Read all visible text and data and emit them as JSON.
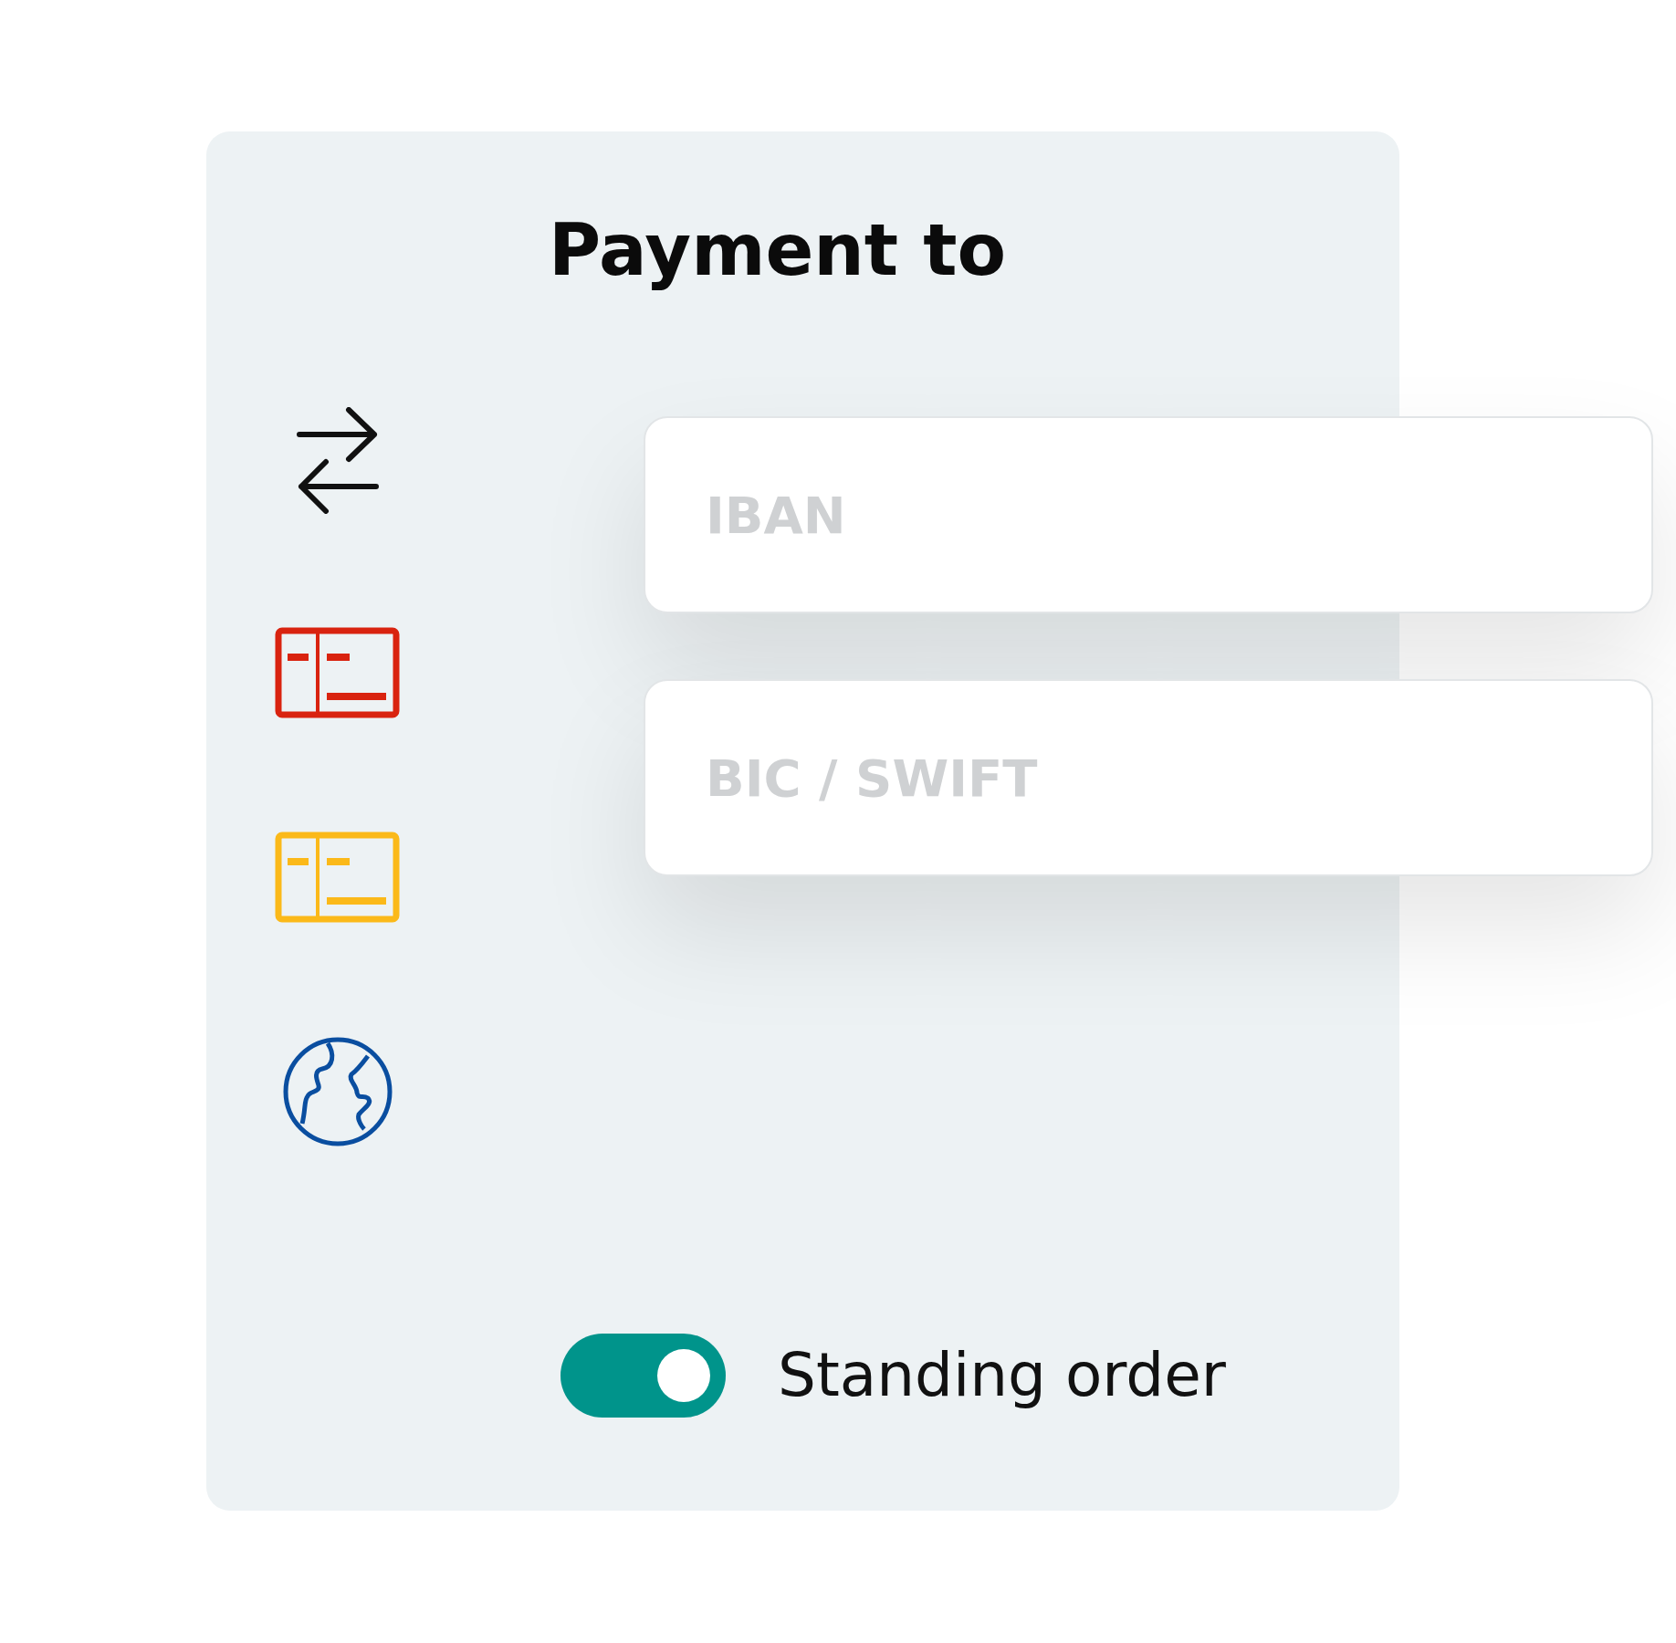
{
  "title": "Payment to",
  "fields": [
    {
      "placeholder": "IBAN"
    },
    {
      "placeholder": "BIC / SWIFT"
    }
  ],
  "standing_order": {
    "label": "Standing order",
    "on": true
  }
}
